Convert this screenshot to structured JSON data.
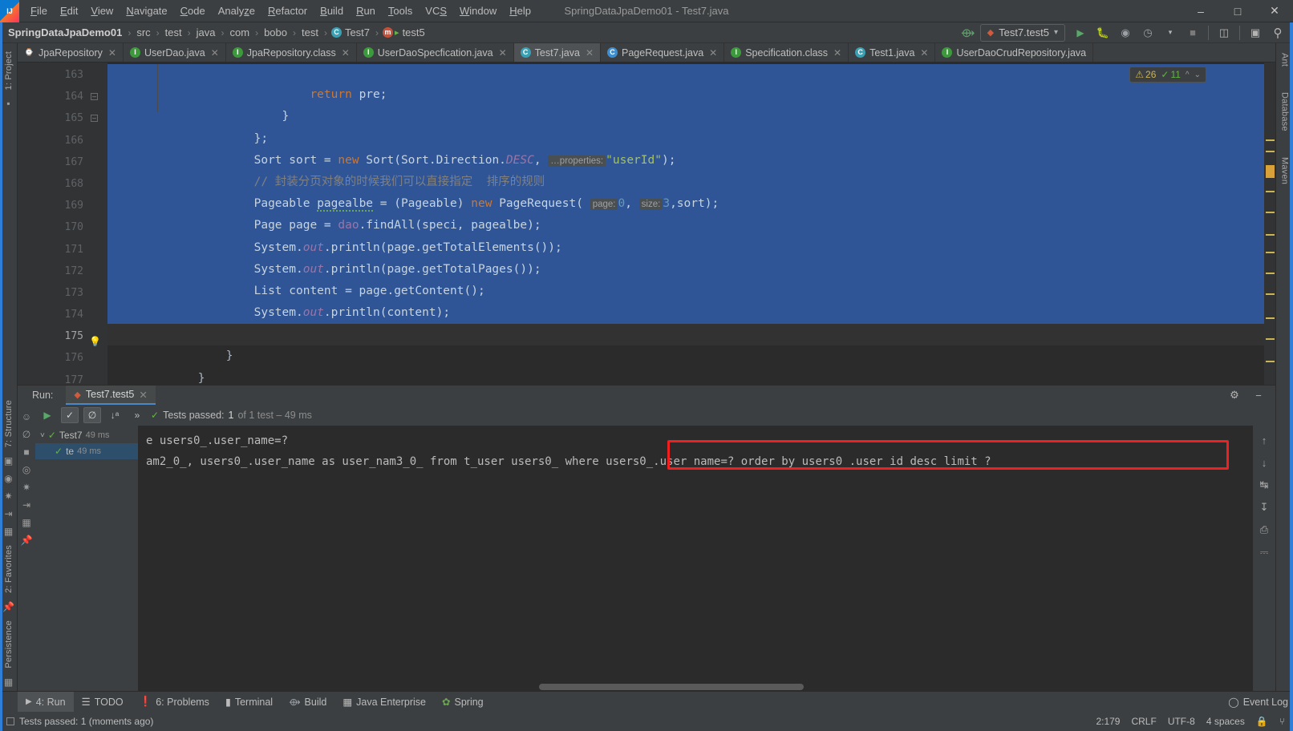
{
  "window": {
    "title": "SpringDataJpaDemo01 - Test7.java",
    "logo": "intellij-idea-logo",
    "controls": [
      "minimize",
      "maximize",
      "close"
    ]
  },
  "menubar": [
    {
      "label": "File",
      "mnemonic": "F"
    },
    {
      "label": "Edit",
      "mnemonic": "E"
    },
    {
      "label": "View",
      "mnemonic": "V"
    },
    {
      "label": "Navigate",
      "mnemonic": "N"
    },
    {
      "label": "Code",
      "mnemonic": "C"
    },
    {
      "label": "Analyze",
      "mnemonic": "z"
    },
    {
      "label": "Refactor",
      "mnemonic": "R"
    },
    {
      "label": "Build",
      "mnemonic": "B"
    },
    {
      "label": "Run",
      "mnemonic": "R"
    },
    {
      "label": "Tools",
      "mnemonic": "T"
    },
    {
      "label": "VCS",
      "mnemonic": "S"
    },
    {
      "label": "Window",
      "mnemonic": "W"
    },
    {
      "label": "Help",
      "mnemonic": "H"
    }
  ],
  "breadcrumb": {
    "items": [
      {
        "label": "SpringDataJpaDemo01",
        "icon": null,
        "bold": true
      },
      {
        "label": "src",
        "icon": null
      },
      {
        "label": "test",
        "icon": null
      },
      {
        "label": "java",
        "icon": null
      },
      {
        "label": "com",
        "icon": null
      },
      {
        "label": "bobo",
        "icon": null
      },
      {
        "label": "test",
        "icon": null
      },
      {
        "label": "Test7",
        "icon": "class-icon"
      },
      {
        "label": "test5",
        "icon": "method-test-icon"
      }
    ],
    "separator": "›"
  },
  "toolbar": {
    "build_icon": "hammer-icon",
    "run_config": "Test7.test5",
    "run_config_caret": "▾",
    "buttons": [
      {
        "name": "run-button",
        "glyph": "▶"
      },
      {
        "name": "debug-button",
        "glyph": "🐞"
      },
      {
        "name": "run-with-coverage-button",
        "glyph": "▶"
      },
      {
        "name": "profiler-button",
        "glyph": "◔"
      },
      {
        "name": "stop-button",
        "glyph": "■"
      },
      {
        "name": "update-project-button",
        "glyph": "▣"
      },
      {
        "name": "select-opened-file-button",
        "glyph": "□"
      },
      {
        "name": "search-everywhere-button",
        "glyph": "⌕"
      }
    ]
  },
  "editor_tabs": [
    {
      "label": "JpaRepository",
      "icon": "repository-icon",
      "active": false,
      "closable": true
    },
    {
      "label": "UserDao.java",
      "icon": "interface-icon",
      "active": false,
      "closable": true
    },
    {
      "label": "JpaRepository.class",
      "icon": "interface-lib-icon",
      "active": false,
      "closable": true
    },
    {
      "label": "UserDaoSpecfication.java",
      "icon": "interface-icon",
      "active": false,
      "closable": true
    },
    {
      "label": "Test7.java",
      "icon": "test-class-icon",
      "active": true,
      "closable": true
    },
    {
      "label": "PageRequest.java",
      "icon": "class-lib-icon",
      "active": false,
      "closable": true
    },
    {
      "label": "Specification.class",
      "icon": "interface-lib-icon",
      "active": false,
      "closable": true
    },
    {
      "label": "Test1.java",
      "icon": "test-class-icon",
      "active": false,
      "closable": true
    },
    {
      "label": "UserDaoCrudRepository.java",
      "icon": "interface-icon",
      "active": false,
      "closable": false
    }
  ],
  "editor": {
    "first_visible_line": 163,
    "lines": [
      {
        "number": "163",
        "selected": true
      },
      {
        "number": "164",
        "selected": true,
        "fold": true
      },
      {
        "number": "165",
        "selected": true,
        "fold": true
      },
      {
        "number": "166",
        "selected": true
      },
      {
        "number": "167",
        "selected": true
      },
      {
        "number": "168",
        "selected": true
      },
      {
        "number": "169",
        "selected": true
      },
      {
        "number": "170",
        "selected": true
      },
      {
        "number": "171",
        "selected": true
      },
      {
        "number": "172",
        "selected": true
      },
      {
        "number": "173",
        "selected": true
      },
      {
        "number": "174",
        "selected": true
      },
      {
        "number": "175",
        "selected": false,
        "bulb": true
      },
      {
        "number": "176",
        "selected": false
      },
      {
        "number": "177",
        "selected": false
      }
    ],
    "code": {
      "l163": {
        "kw": "return",
        "rest": " pre;"
      },
      "l164": "}",
      "l165": "};",
      "l166": {
        "a": "Sort sort = ",
        "kw": "new",
        "b": " Sort(Sort.Direction.",
        "field": "DESC",
        "c": ", ",
        "hint": "…properties:",
        "str": "\"userId\"",
        "d": ");"
      },
      "l167": "// 封装分页对象的时候我们可以直接指定  排序的规则",
      "l168": {
        "a": "Pageable pagealbe = (",
        "cast": "Pageable",
        "b": ") ",
        "kw": "new",
        "c": " PageRequest( ",
        "hint1": "page:",
        "n1": "0",
        "comma": ", ",
        "hint2": "size:",
        "n2": "3",
        "d": ",sort);"
      },
      "l169": {
        "a": "Page page = ",
        "obj": "dao",
        "b": ".findAll(speci, pagealbe);"
      },
      "l170": {
        "a": "System.",
        "fld": "out",
        "b": ".println(page.getTotalElements());"
      },
      "l171": {
        "a": "System.",
        "fld": "out",
        "b": ".println(page.getTotalPages());"
      },
      "l172": "List content = page.getContent();",
      "l173": {
        "a": "System.",
        "fld": "out",
        "b": ".println(content);"
      },
      "l174": "",
      "l175": "}",
      "l176": "}",
      "l177": ""
    },
    "inspection_widget": {
      "warning_icon": "warning-triangle-icon",
      "warning_count": "26",
      "ok_icon": "checkmark-icon",
      "ok_count": "11",
      "up_arrow": "⌃",
      "down_arrow": "⌄"
    }
  },
  "run_window": {
    "label": "Run:",
    "tab_label": "Test7.test5",
    "tab_icon": "run-config-icon",
    "tab_close": "×",
    "settings_icon": "gear-icon",
    "minimize_icon": "minimize-icon",
    "toolbar": {
      "rerun_icon": "green-play-icon",
      "show_passed_toggle": "checkmark-toggle",
      "show_ignored_toggle": "ignored-toggle",
      "sort_alpha_icon": "sort-alphabetically-icon",
      "expand_icon": "»",
      "status_prefix": "Tests passed:",
      "status_count": "1",
      "status_suffix": "of 1 test – 49 ms"
    },
    "tree": [
      {
        "label": "Test7",
        "time": "49 ms",
        "expanded": true,
        "selected": false,
        "depth": 0
      },
      {
        "label": "te",
        "time": "49 ms",
        "expanded": false,
        "selected": true,
        "depth": 1
      }
    ],
    "console_lines": [
      "e users0_.user_name=?",
      "am2_0_, users0_.user_name as user_nam3_0_ from t_user users0_ where users0_.user_name=? order by users0_.user_id desc limit ?"
    ],
    "highlight": {
      "color": "#f02020",
      "text": "where users0_.user_name=? order by users0_.user_id desc limit ?"
    },
    "side_tools": [
      {
        "name": "rerun-failed-icon",
        "glyph": "↻"
      },
      {
        "name": "up-stacktrace-icon",
        "glyph": "↑"
      },
      {
        "name": "down-stacktrace-icon",
        "glyph": "↓"
      },
      {
        "name": "soft-wrap-icon",
        "glyph": "↩"
      },
      {
        "name": "scroll-to-end-icon",
        "glyph": "↡"
      },
      {
        "name": "print-icon",
        "glyph": "⎙"
      },
      {
        "name": "clear-all-icon",
        "glyph": "🗑"
      }
    ],
    "left_tools": [
      {
        "name": "console-icon",
        "glyph": "⎙"
      },
      {
        "name": "suppress-icon",
        "glyph": "⊘"
      },
      {
        "name": "stop-icon",
        "glyph": "■"
      },
      {
        "name": "screenshot-icon",
        "glyph": "◎"
      },
      {
        "name": "export-icon",
        "glyph": "✱"
      },
      {
        "name": "import-icon",
        "glyph": "⇥"
      },
      {
        "name": "layout-icon",
        "glyph": "▦"
      },
      {
        "name": "pin-icon",
        "glyph": "📌"
      }
    ]
  },
  "left_strip": [
    {
      "label": "1: Project",
      "name": "sidebar-project",
      "active": false
    },
    {
      "label": "7: Structure",
      "name": "sidebar-structure",
      "active": false
    },
    {
      "label": "2: Favorites",
      "name": "sidebar-favorites",
      "active": false
    },
    {
      "label": "Persistence",
      "name": "sidebar-persistence",
      "active": false
    }
  ],
  "right_strip": [
    {
      "label": "Ant",
      "name": "sidebar-ant"
    },
    {
      "label": "Database",
      "name": "sidebar-database"
    },
    {
      "label": "Maven",
      "name": "sidebar-maven"
    }
  ],
  "bottom_bar": [
    {
      "label": "4: Run",
      "mnemonic": "4",
      "icon": "play-icon",
      "active": true,
      "name": "tool-window-run"
    },
    {
      "label": "TODO",
      "icon": "list-icon",
      "active": false,
      "name": "tool-window-todo"
    },
    {
      "label": "6: Problems",
      "mnemonic": "6",
      "icon": "error-icon",
      "active": false,
      "name": "tool-window-problems"
    },
    {
      "label": "Terminal",
      "icon": "terminal-icon",
      "active": false,
      "name": "tool-window-terminal"
    },
    {
      "label": "Build",
      "icon": "hammer-icon",
      "active": false,
      "name": "tool-window-build"
    },
    {
      "label": "Java Enterprise",
      "icon": "java-ee-icon",
      "active": false,
      "name": "tool-window-java-enterprise"
    },
    {
      "label": "Spring",
      "icon": "spring-leaf-icon",
      "active": false,
      "name": "tool-window-spring"
    }
  ],
  "event_log": {
    "label": "Event Log",
    "icon": "balloon-icon"
  },
  "statusbar": {
    "message": "Tests passed: 1 (moments ago)",
    "message_icon": "square-icon",
    "caret_position": "2:179",
    "line_separator": "CRLF",
    "encoding": "UTF-8",
    "indent": "4 spaces",
    "lock_icon": "lock-icon",
    "branch_icon": "branch-icon"
  },
  "colors": {
    "accent": "#2f7fd8",
    "selection": "#2f5597",
    "chrome": "#3c3f41",
    "editor_bg": "#2b2b2b",
    "highlight_red": "#f02020",
    "success_green": "#62b543"
  }
}
